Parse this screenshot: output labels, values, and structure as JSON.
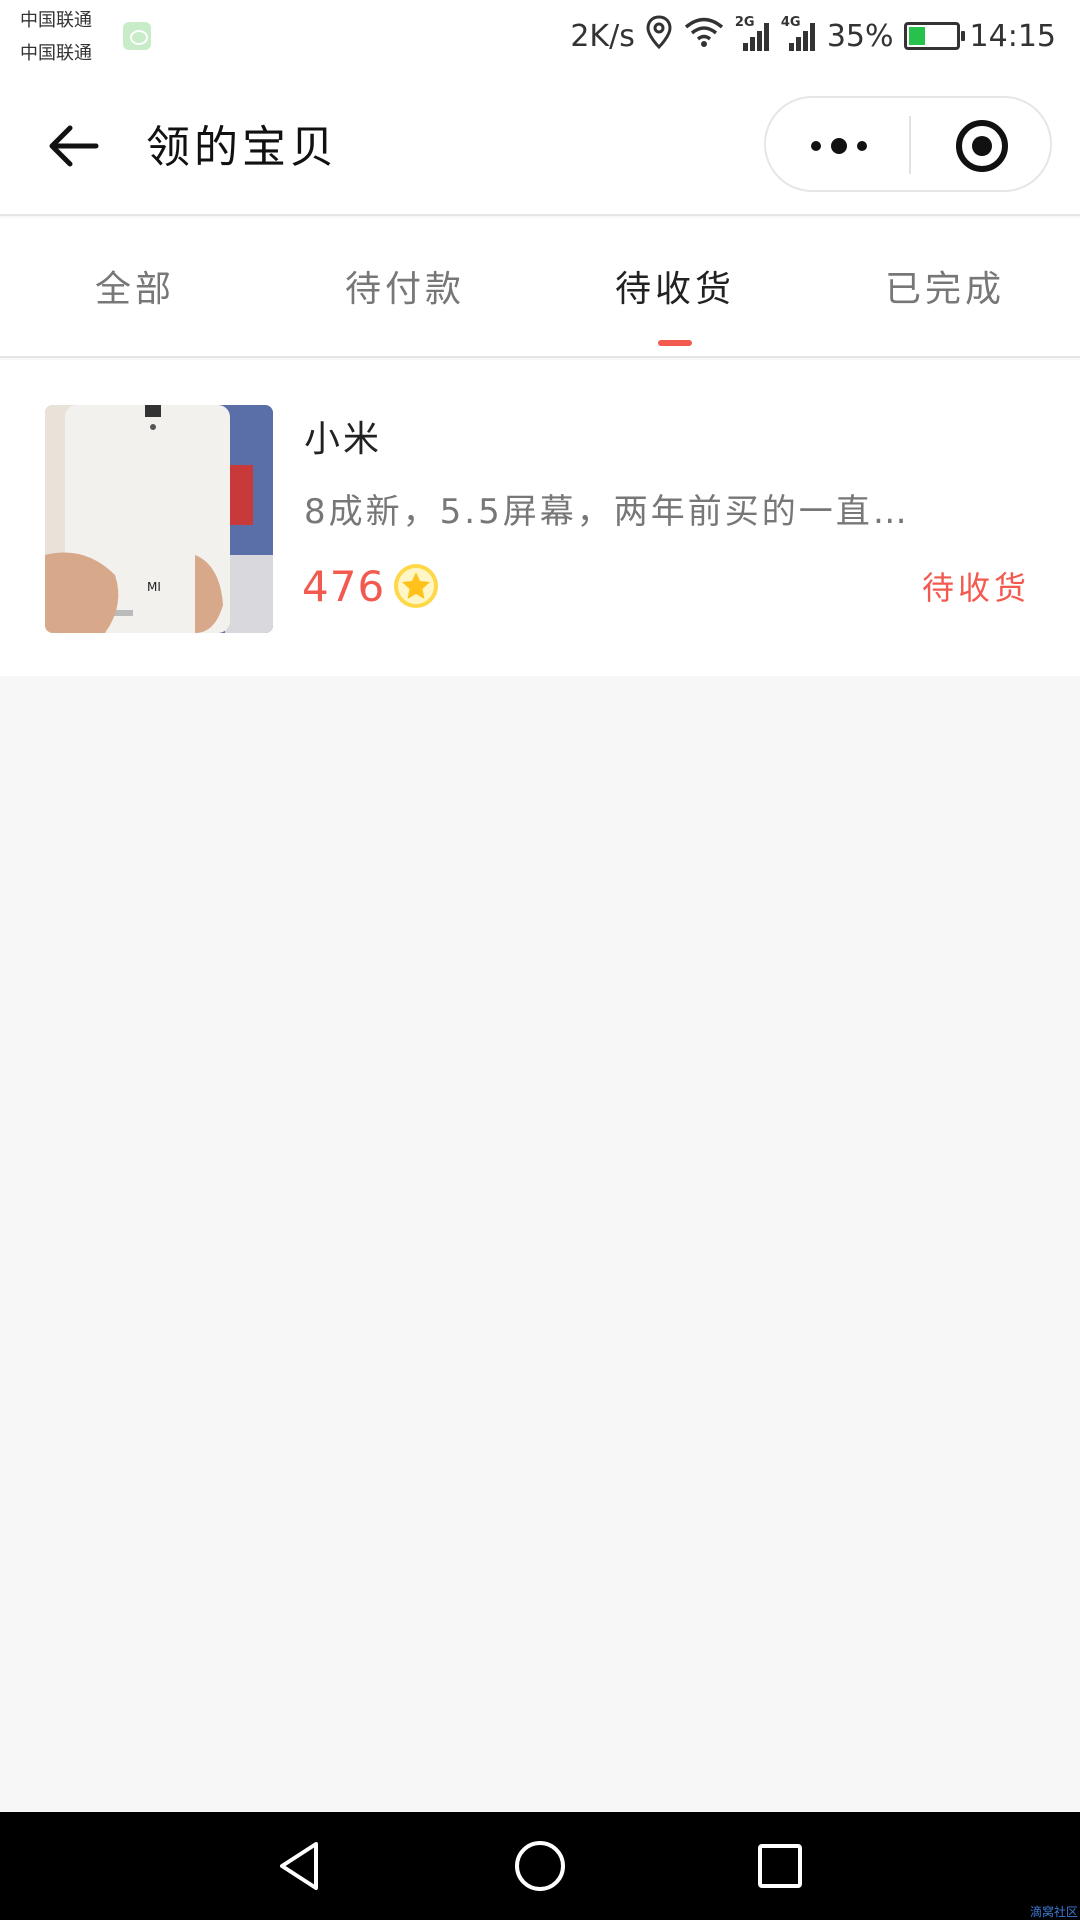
{
  "status_bar": {
    "carrier_1": "中国联通",
    "carrier_2": "中国联通",
    "speed": "2K/s",
    "net_1": "2G",
    "net_2": "4G",
    "battery": "35%",
    "battery_level": 0.35,
    "time": "14:15"
  },
  "header": {
    "title": "领的宝贝"
  },
  "tabs": [
    {
      "label": "全部",
      "active": false
    },
    {
      "label": "待付款",
      "active": false
    },
    {
      "label": "待收货",
      "active": true
    },
    {
      "label": "已完成",
      "active": false
    }
  ],
  "items": [
    {
      "name": "小米",
      "description": "8成新，5.5屏幕，两年前买的一直…",
      "price": "476",
      "status": "待收货",
      "thumb_icon": "phone-photo"
    }
  ],
  "colors": {
    "accent": "#f25a4f",
    "coin": "#ffd84a",
    "background": "#f7f7f7"
  },
  "watermark": "滴窝社区"
}
